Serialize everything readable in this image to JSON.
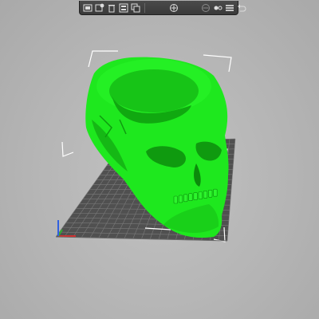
{
  "app": {
    "background_color": "#b8b8b8",
    "model_color": "#1ee81e",
    "bed_color": "#505050",
    "grid_line_color": "#7a7a7a"
  },
  "toolbar": {
    "buttons": [
      {
        "name": "add-object-button",
        "icon": "add-object-icon"
      },
      {
        "name": "delete-button",
        "icon": "delete-icon"
      },
      {
        "name": "delete-all-button",
        "icon": "trash-icon"
      },
      {
        "name": "arrange-button",
        "icon": "arrange-icon"
      },
      {
        "name": "copy-button",
        "icon": "copy-icon"
      },
      {
        "name": "paste-button",
        "icon": "paste-icon"
      },
      {
        "name": "add-instance-button",
        "icon": "add-instance-icon"
      },
      {
        "name": "remove-instance-button",
        "icon": "remove-instance-icon"
      },
      {
        "name": "split-button",
        "icon": "split-icon"
      },
      {
        "name": "layers-button",
        "icon": "layers-icon"
      },
      {
        "name": "undo-button",
        "icon": "undo-icon"
      }
    ]
  },
  "scene": {
    "axes": {
      "x_color": "#d03030",
      "y_color": "#30b030",
      "z_color": "#3060e0"
    }
  }
}
